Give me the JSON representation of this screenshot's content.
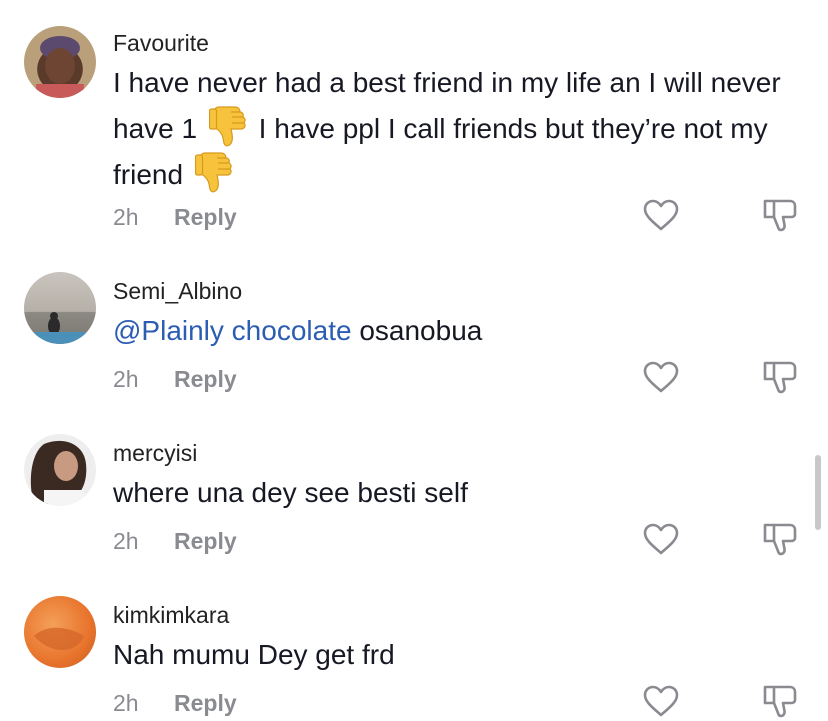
{
  "comments": [
    {
      "username": "Favourite",
      "text_part1": "I have never had a best friend in my life an I will never have 1",
      "text_part2": "I have ppl I call friends but they’re not my friend",
      "time": "2h",
      "reply_label": "Reply",
      "avatar_icon": "avatar-photo-woman"
    },
    {
      "username": "Semi_Albino",
      "mention": "@Plainly chocolate",
      "text": "osanobua",
      "time": "2h",
      "reply_label": "Reply",
      "avatar_icon": "avatar-photo-beach"
    },
    {
      "username": "mercyisi",
      "text": "where una dey see besti self",
      "time": "2h",
      "reply_label": "Reply",
      "avatar_icon": "avatar-photo-woman-hair"
    },
    {
      "username": "kimkimkara",
      "text": "Nah mumu Dey get frd",
      "time": "2h",
      "reply_label": "Reply",
      "avatar_icon": "avatar-photo-orange"
    }
  ],
  "icons": {
    "like": "heart-icon",
    "dislike": "thumbs-down-icon",
    "emoji": "thumbs-down-emoji"
  },
  "colors": {
    "mention": "#2b5db3",
    "meta": "#8a8b91",
    "emoji": "#f7c23c"
  }
}
